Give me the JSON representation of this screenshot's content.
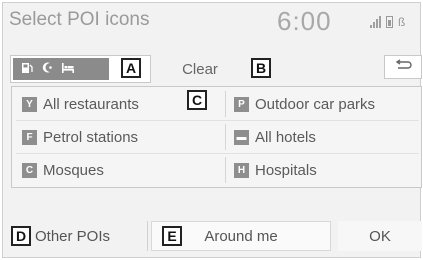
{
  "header": {
    "title": "Select POI icons",
    "time": "6:00"
  },
  "toolbar": {
    "category_icons": [
      "fuel-icon",
      "mosque-icon",
      "hotel-icon"
    ],
    "clear_label": "Clear",
    "back_icon": "back-arrow-icon"
  },
  "callouts": {
    "a": "A",
    "b": "B",
    "c": "C",
    "d": "D",
    "e": "E"
  },
  "poi": {
    "items": [
      {
        "label": "All restaurants",
        "icon": "restaurant-icon",
        "glyph": "Y"
      },
      {
        "label": "Outdoor car parks",
        "icon": "parking-icon",
        "glyph": "P"
      },
      {
        "label": "Petrol stations",
        "icon": "fuel-icon",
        "glyph": "F"
      },
      {
        "label": "All hotels",
        "icon": "hotel-icon",
        "glyph": "▬"
      },
      {
        "label": "Mosques",
        "icon": "mosque-icon",
        "glyph": "C"
      },
      {
        "label": "Hospitals",
        "icon": "hospital-icon",
        "glyph": "H"
      }
    ]
  },
  "footer": {
    "other_label": "Other POIs",
    "around_label": "Around me",
    "ok_label": "OK"
  }
}
